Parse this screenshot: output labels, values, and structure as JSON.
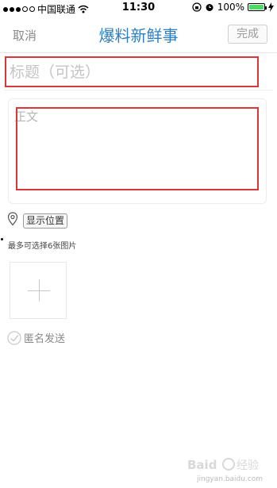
{
  "status_bar": {
    "carrier": "中国联通",
    "time": "11:30",
    "battery": "100%",
    "battery_level": 1.0,
    "signal_dots_filled": 3,
    "signal_dots_total": 5
  },
  "nav": {
    "cancel_label": "取消",
    "title": "爆料新鲜事",
    "done_label": "完成",
    "title_color": "#2e7fc2"
  },
  "title_field": {
    "placeholder": "标题（可选）",
    "value": ""
  },
  "body_field": {
    "placeholder": "正文"
  },
  "location": {
    "label": "显示位置",
    "icon": "location-pin-icon"
  },
  "photos": {
    "hint": "最多可选择6张图片",
    "add_icon": "plus-icon"
  },
  "anonymous": {
    "label": "匿名发送",
    "checked": false,
    "icon": "check-circle-icon"
  },
  "watermark": {
    "text": "jingyan.baidu.com"
  },
  "accent_colors": {
    "highlight_border": "#d9383a",
    "battery_fill": "#4cd964"
  }
}
